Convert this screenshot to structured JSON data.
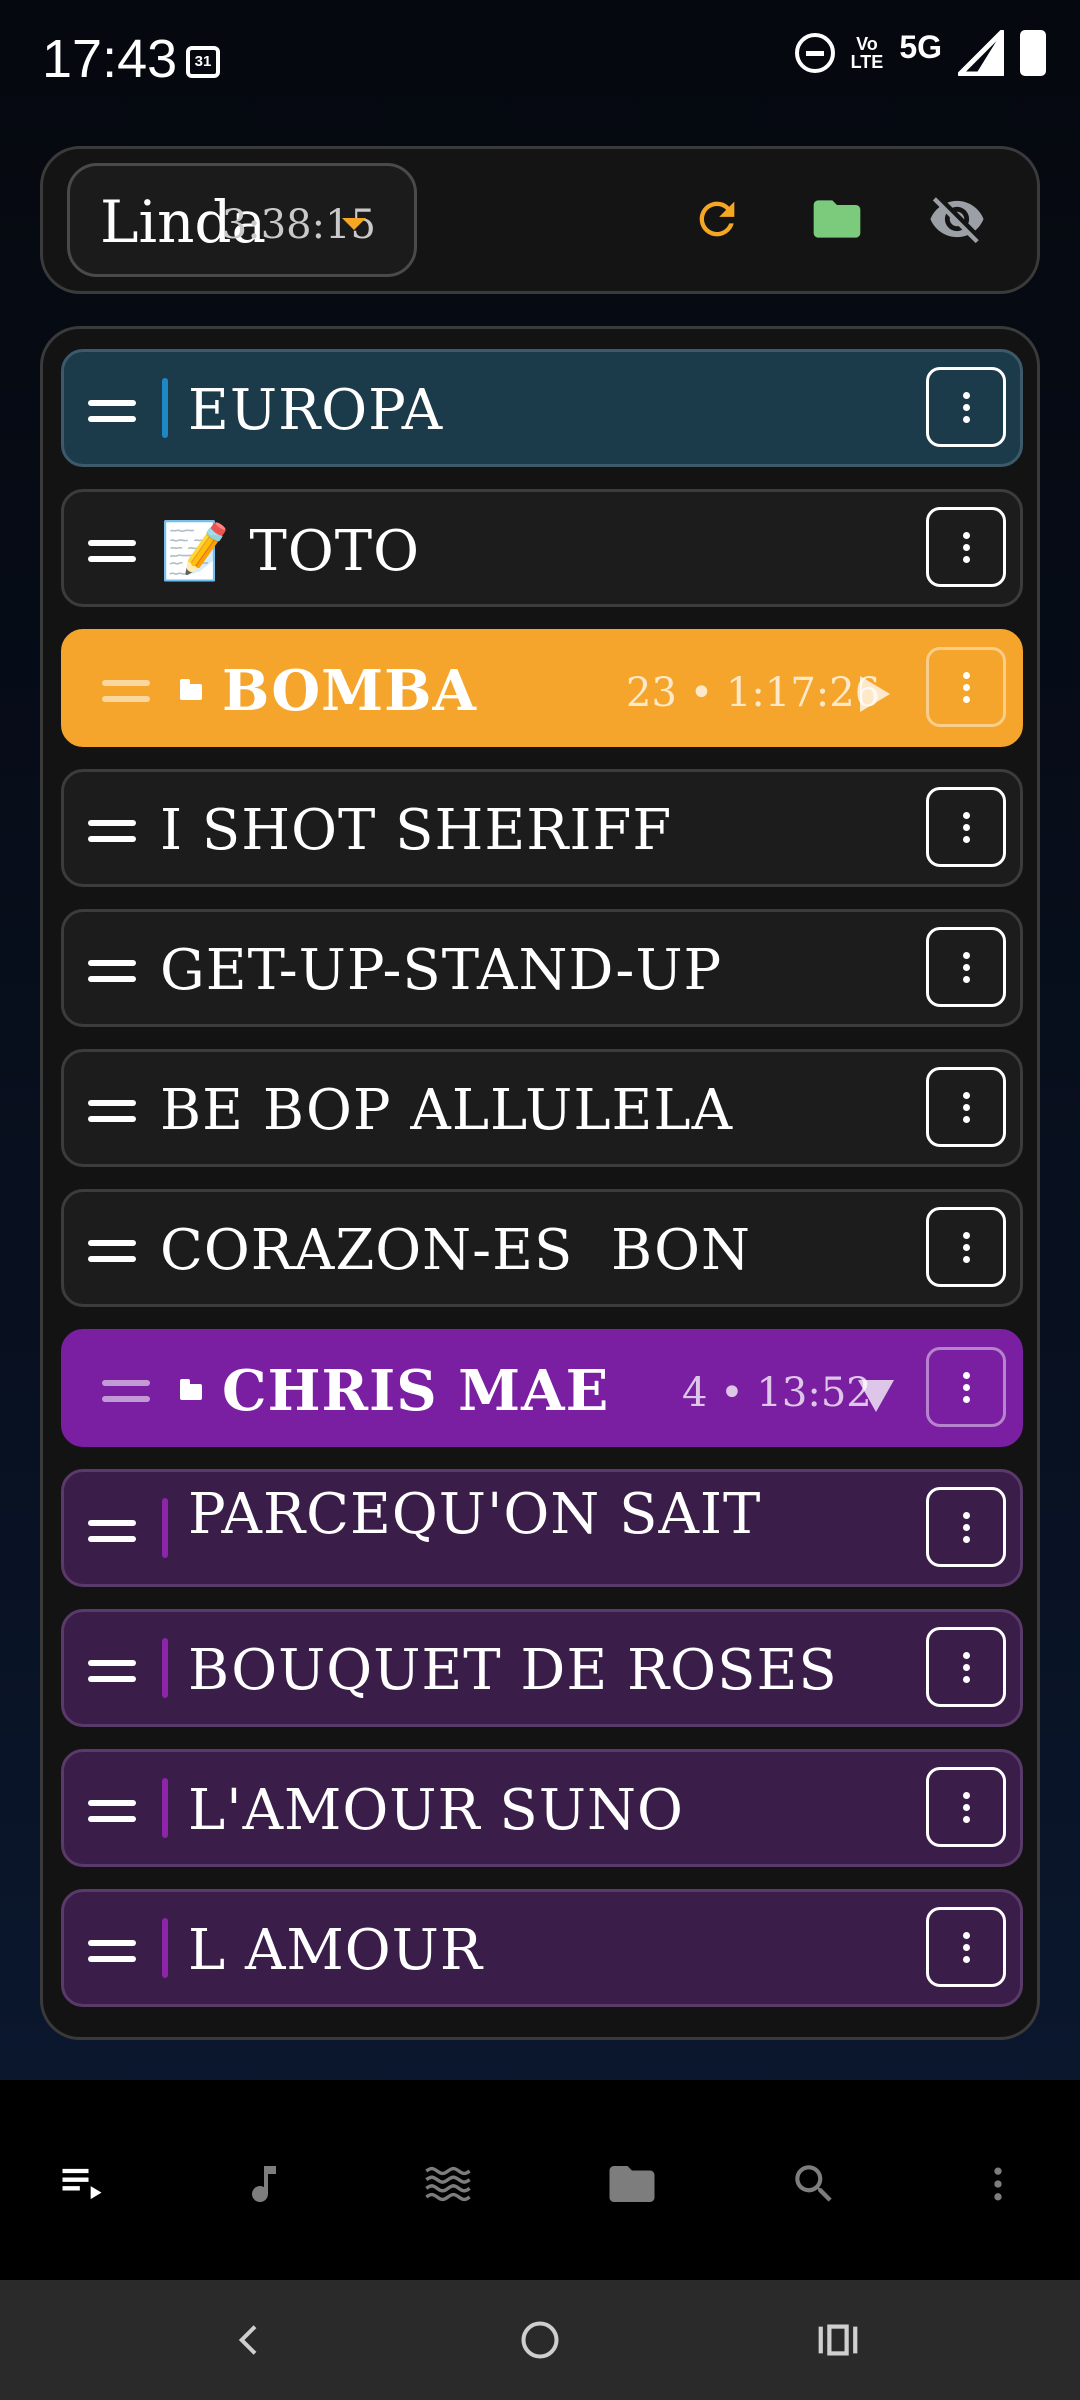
{
  "status_bar": {
    "time": "17:43",
    "calendar_day": "31",
    "network": "5G",
    "volte_line1": "Vo",
    "volte_line2": "LTE"
  },
  "header": {
    "playlist_name": "Linda",
    "playlist_duration": "3:38:15",
    "colors": {
      "refresh": "#f5a623",
      "folder": "#7ccb7c",
      "visibility": "#9aa0a6"
    }
  },
  "list": {
    "items": [
      {
        "title": "EUROPA",
        "style": "blue-child",
        "accent": "#1e88c7"
      },
      {
        "title": "📝 TOTO",
        "style": "plain"
      },
      {
        "title": "BOMBA",
        "style": "folder-orange",
        "count": "23",
        "duration": "1:17:26",
        "state": "collapsed"
      },
      {
        "title": "I SHOT SHERIFF",
        "style": "plain"
      },
      {
        "title": "GET-UP-STAND-UP",
        "style": "plain"
      },
      {
        "title": "BE BOP ALLULELA",
        "style": "plain"
      },
      {
        "title": "CORAZON-ES  BON",
        "style": "plain"
      },
      {
        "title": "CHRIS MAE",
        "style": "folder-purple",
        "count": "4",
        "duration": "13:52",
        "state": "expanded"
      },
      {
        "title": "PARCEQU'ON SAIT",
        "style": "purple-child",
        "accent": "#8e24aa"
      },
      {
        "title": "BOUQUET DE ROSES",
        "style": "purple-child",
        "accent": "#8e24aa"
      },
      {
        "title": "L'AMOUR SUNO",
        "style": "purple-child",
        "accent": "#8e24aa"
      },
      {
        "title": "L AMOUR",
        "style": "purple-child",
        "accent": "#8e24aa"
      }
    ],
    "meta_separator": "•"
  },
  "bottom_nav": {
    "items": [
      "queue-icon",
      "music-note-icon",
      "waves-icon",
      "folder-icon",
      "search-icon",
      "more-vert-icon"
    ]
  }
}
